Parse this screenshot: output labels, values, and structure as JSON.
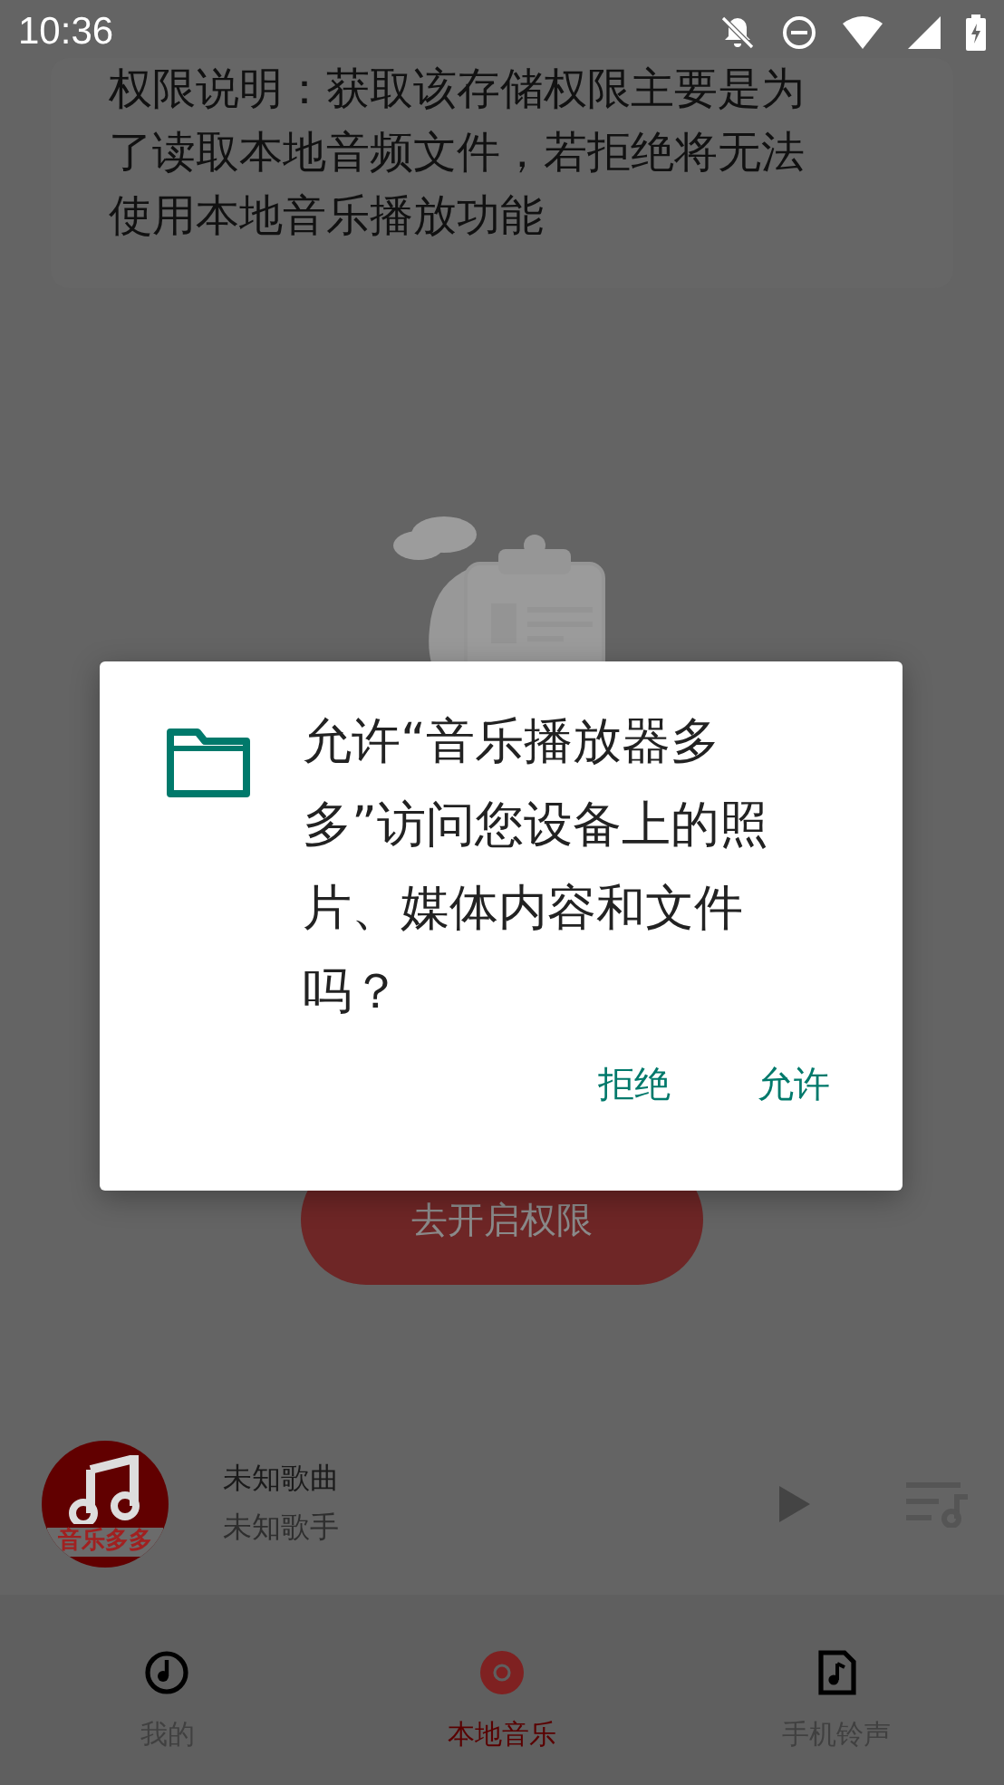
{
  "status_bar": {
    "time": "10:36"
  },
  "permission_note": {
    "text": "权限说明：获取该存储权限主要是为了读取本地音频文件，若拒绝将无法使用本地音乐播放功能"
  },
  "enable_button": {
    "label": "去开启权限"
  },
  "mini_player": {
    "logo_text": "音乐多多",
    "title": "未知歌曲",
    "artist": "未知歌手"
  },
  "bottom_nav": [
    {
      "label": "我的",
      "kind": "mine",
      "selected": false
    },
    {
      "label": "本地音乐",
      "kind": "local",
      "selected": true
    },
    {
      "label": "手机铃声",
      "kind": "ringtone",
      "selected": false
    }
  ],
  "dialog": {
    "message": "允许“音乐播放器多多”访问您设备上的照片、媒体内容和文件吗？",
    "buttons": [
      {
        "label": "拒绝"
      },
      {
        "label": "允许"
      }
    ]
  }
}
